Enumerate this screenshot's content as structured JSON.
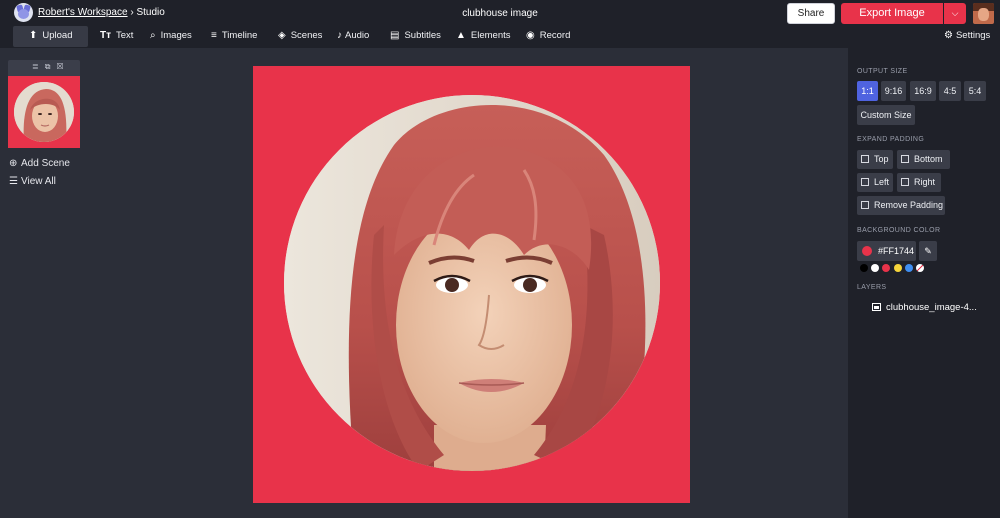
{
  "header": {
    "workspace_link": "Robert's Workspace",
    "breadcrumb_sep": " › ",
    "breadcrumb_current": "Studio",
    "title": "clubhouse image",
    "share_label": "Share",
    "export_label": "Export Image"
  },
  "toolbar": {
    "items": [
      {
        "label": "Upload",
        "icon": "upload-icon"
      },
      {
        "label": "Text",
        "icon": "text-icon"
      },
      {
        "label": "Images",
        "icon": "search-icon"
      },
      {
        "label": "Timeline",
        "icon": "timeline-icon"
      },
      {
        "label": "Scenes",
        "icon": "layers-icon"
      },
      {
        "label": "Audio",
        "icon": "music-note-icon"
      },
      {
        "label": "Subtitles",
        "icon": "subtitles-icon"
      },
      {
        "label": "Elements",
        "icon": "shapes-icon"
      },
      {
        "label": "Record",
        "icon": "record-icon"
      }
    ],
    "settings_label": "Settings"
  },
  "left_panel": {
    "add_scene": "Add Scene",
    "view_all": "View All"
  },
  "right_panel": {
    "output_size_title": "OUTPUT SIZE",
    "sizes": [
      "1:1",
      "9:16",
      "16:9",
      "4:5",
      "5:4"
    ],
    "selected_size": "1:1",
    "custom_size": "Custom Size",
    "expand_padding_title": "EXPAND PADDING",
    "padding": {
      "top": "Top",
      "bottom": "Bottom",
      "left": "Left",
      "right": "Right",
      "remove": "Remove Padding"
    },
    "background_title": "BACKGROUND COLOR",
    "background_hex": "#FF1744",
    "swatches": [
      "#000000",
      "#ffffff",
      "#e8334a",
      "#f5d43b",
      "#3f8ef0",
      "transparent"
    ],
    "layers_title": "LAYERS",
    "layer_name": "clubhouse_image-4..."
  },
  "colors": {
    "accent": "#e8334a",
    "selected_chip": "#4f63e0",
    "canvas_bg": "#e8334a"
  }
}
